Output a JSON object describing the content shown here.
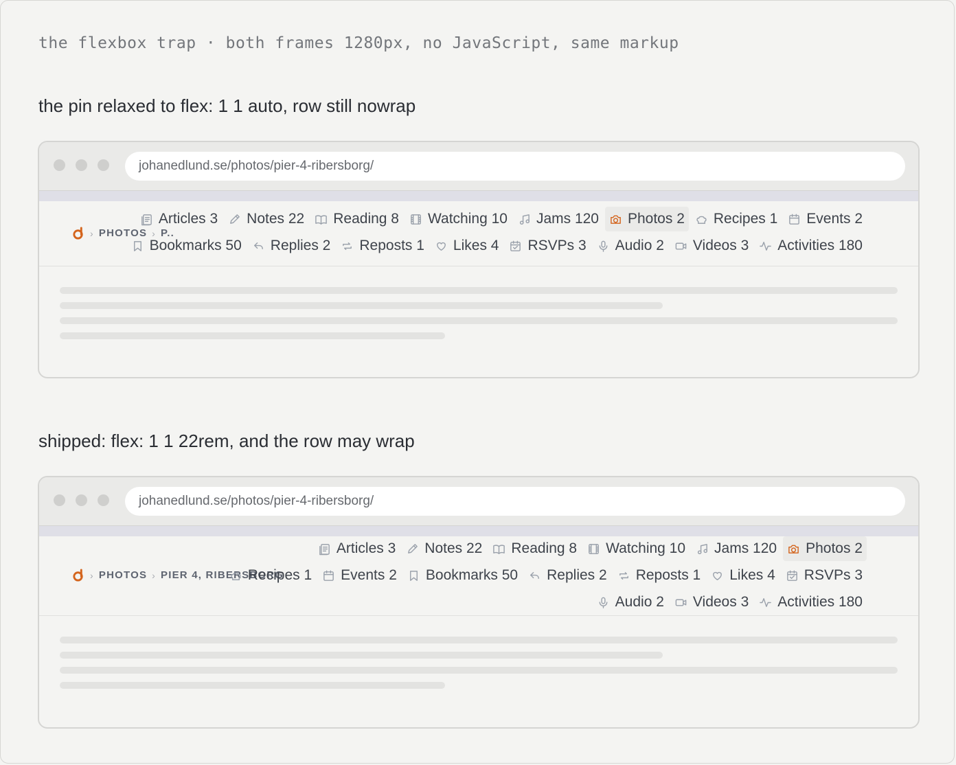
{
  "page": {
    "title": "the flexbox trap · both frames 1280px, no JavaScript, same markup"
  },
  "colors": {
    "accent": "#d4641c",
    "icon": "#9aa1ab",
    "text": "#3e434b",
    "active_bg": "#eaeae8"
  },
  "sections": [
    {
      "heading": "the pin relaxed to flex: 1 1 auto, row still nowrap",
      "url": "johanedlund.se/photos/pier-4-ribersborg/",
      "breadcrumb": {
        "section": "PHOTOS",
        "current": "P.."
      }
    },
    {
      "heading": "shipped: flex: 1 1 22rem, and the row may wrap",
      "url": "johanedlund.se/photos/pier-4-ribersborg/",
      "breadcrumb": {
        "section": "PHOTOS",
        "current": "PIER 4, RIBERSBORG"
      }
    }
  ],
  "nav_items": [
    {
      "label": "Articles 3",
      "icon": "articles-icon"
    },
    {
      "label": "Notes 22",
      "icon": "pencil-icon"
    },
    {
      "label": "Reading 8",
      "icon": "book-icon"
    },
    {
      "label": "Watching 10",
      "icon": "film-icon"
    },
    {
      "label": "Jams 120",
      "icon": "music-note-icon"
    },
    {
      "label": "Photos 2",
      "icon": "camera-icon",
      "active": true
    },
    {
      "label": "Recipes 1",
      "icon": "chef-hat-icon"
    },
    {
      "label": "Events 2",
      "icon": "calendar-icon"
    },
    {
      "label": "Bookmarks 50",
      "icon": "bookmark-icon"
    },
    {
      "label": "Replies 2",
      "icon": "reply-icon"
    },
    {
      "label": "Reposts 1",
      "icon": "repost-icon"
    },
    {
      "label": "Likes 4",
      "icon": "heart-icon"
    },
    {
      "label": "RSVPs 3",
      "icon": "calendar-check-icon"
    },
    {
      "label": "Audio 2",
      "icon": "microphone-icon"
    },
    {
      "label": "Videos 3",
      "icon": "video-camera-icon"
    },
    {
      "label": "Activities 180",
      "icon": "activity-icon"
    }
  ]
}
